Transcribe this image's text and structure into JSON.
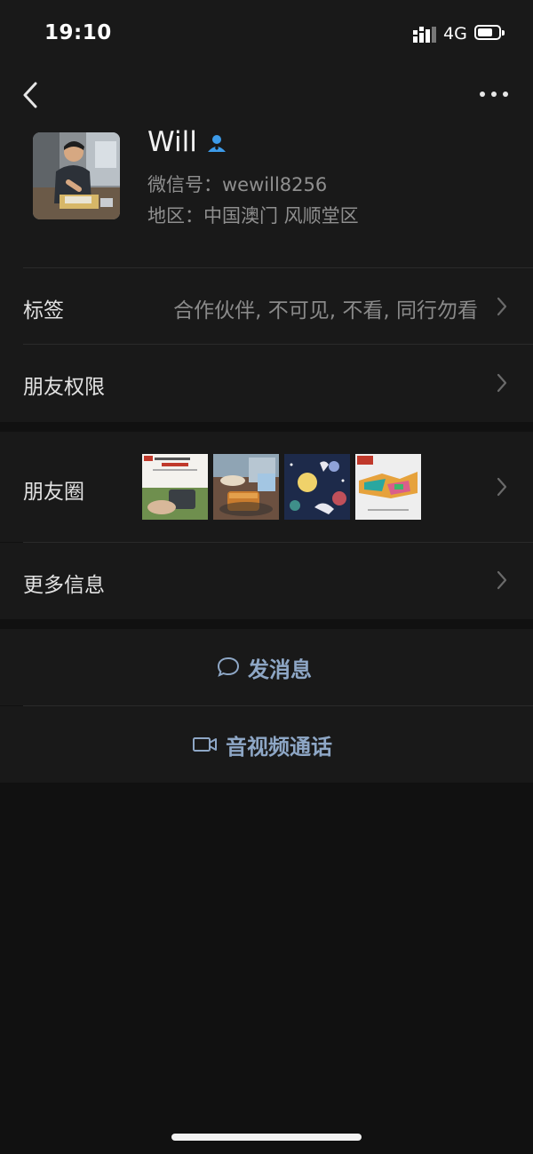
{
  "status_bar": {
    "time": "19:10",
    "network": "4G",
    "icons": [
      "signal-icon",
      "battery-icon"
    ]
  },
  "nav": {
    "back_icon": "chevron-left-icon",
    "more_icon": "more-dots-icon"
  },
  "profile": {
    "name": "Will",
    "verified_icon": "person-badge-icon",
    "wechat_id": "微信号：wewill8256",
    "region": "地区：中国澳门 风顺堂区"
  },
  "rows": {
    "tags": {
      "label": "标签",
      "value": "合作伙伴, 不可见, 不看, 同行勿看"
    },
    "permissions": {
      "label": "朋友权限"
    },
    "moments": {
      "label": "朋友圈"
    },
    "more_info": {
      "label": "更多信息"
    }
  },
  "actions": {
    "message": {
      "label": "发消息",
      "icon": "chat-bubble-icon"
    },
    "call": {
      "label": "音视频通话",
      "icon": "video-camera-icon"
    }
  },
  "colors": {
    "background": "#111111",
    "card": "#191919",
    "accent_link": "#8ea7c6",
    "verified": "#3d9be9"
  }
}
